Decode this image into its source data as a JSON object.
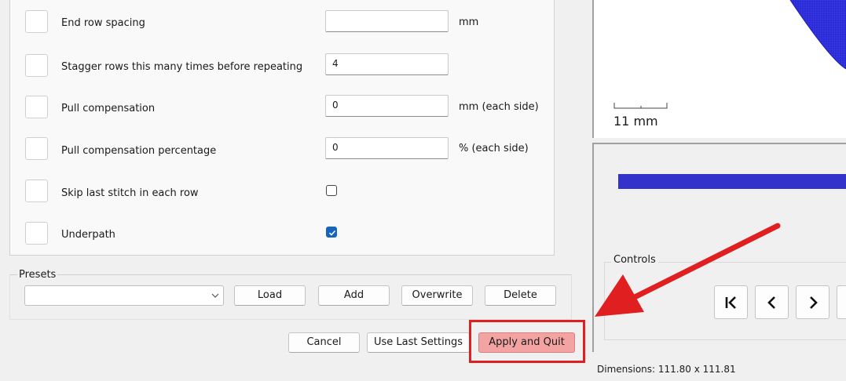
{
  "rows": [
    {
      "label": "End row spacing",
      "value": "",
      "unit": "mm"
    },
    {
      "label": "Stagger rows this many times before repeating",
      "value": "4",
      "unit": ""
    },
    {
      "label": "Pull compensation",
      "value": "0",
      "unit": "mm (each side)"
    },
    {
      "label": "Pull compensation percentage",
      "value": "0",
      "unit": "% (each side)"
    },
    {
      "label": "Skip last stitch in each row",
      "checked": false
    },
    {
      "label": "Underpath",
      "checked": true
    }
  ],
  "presets": {
    "label": "Presets",
    "selected": "",
    "load": "Load",
    "add": "Add",
    "overwrite": "Overwrite",
    "delete": "Delete"
  },
  "footer": {
    "cancel": "Cancel",
    "use_last": "Use Last Settings",
    "apply": "Apply and Quit"
  },
  "preview": {
    "scale_label": "11 mm",
    "stitch_color": "#3333cc"
  },
  "controls": {
    "label": "Controls",
    "buttons": [
      "first-icon",
      "previous-icon",
      "next-icon"
    ]
  },
  "status": {
    "dimensions": "Dimensions: 111.80 x 111.81"
  },
  "annotation": {
    "color": "#e02020"
  }
}
